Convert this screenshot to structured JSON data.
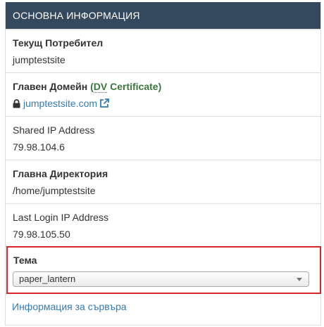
{
  "panel": {
    "title": "Основна Информация",
    "rows": {
      "current_user": {
        "label": "Текущ Потребител",
        "value": "jumptestsite"
      },
      "main_domain": {
        "label": "Главен Домейн",
        "cert_open": "(",
        "cert_abbr": "DV",
        "cert_rest": " Certificate)",
        "value": "jumptestsite.com"
      },
      "shared_ip": {
        "label": "Shared IP Address",
        "value": "79.98.104.6"
      },
      "home_dir": {
        "label": "Главна Директория",
        "value": "/home/jumptestsite"
      },
      "last_login": {
        "label": "Last Login IP Address",
        "value": "79.98.105.50"
      }
    },
    "theme": {
      "label": "Тема",
      "selected": "paper_lantern"
    },
    "server_info_link": "Информация за сървъра"
  },
  "colors": {
    "header_bg": "#34495e",
    "link": "#337ab7",
    "certificate": "#3c763d",
    "highlight_border": "#d9242b"
  },
  "icons": [
    "lock-icon",
    "external-link-icon",
    "chevron-down-icon"
  ]
}
